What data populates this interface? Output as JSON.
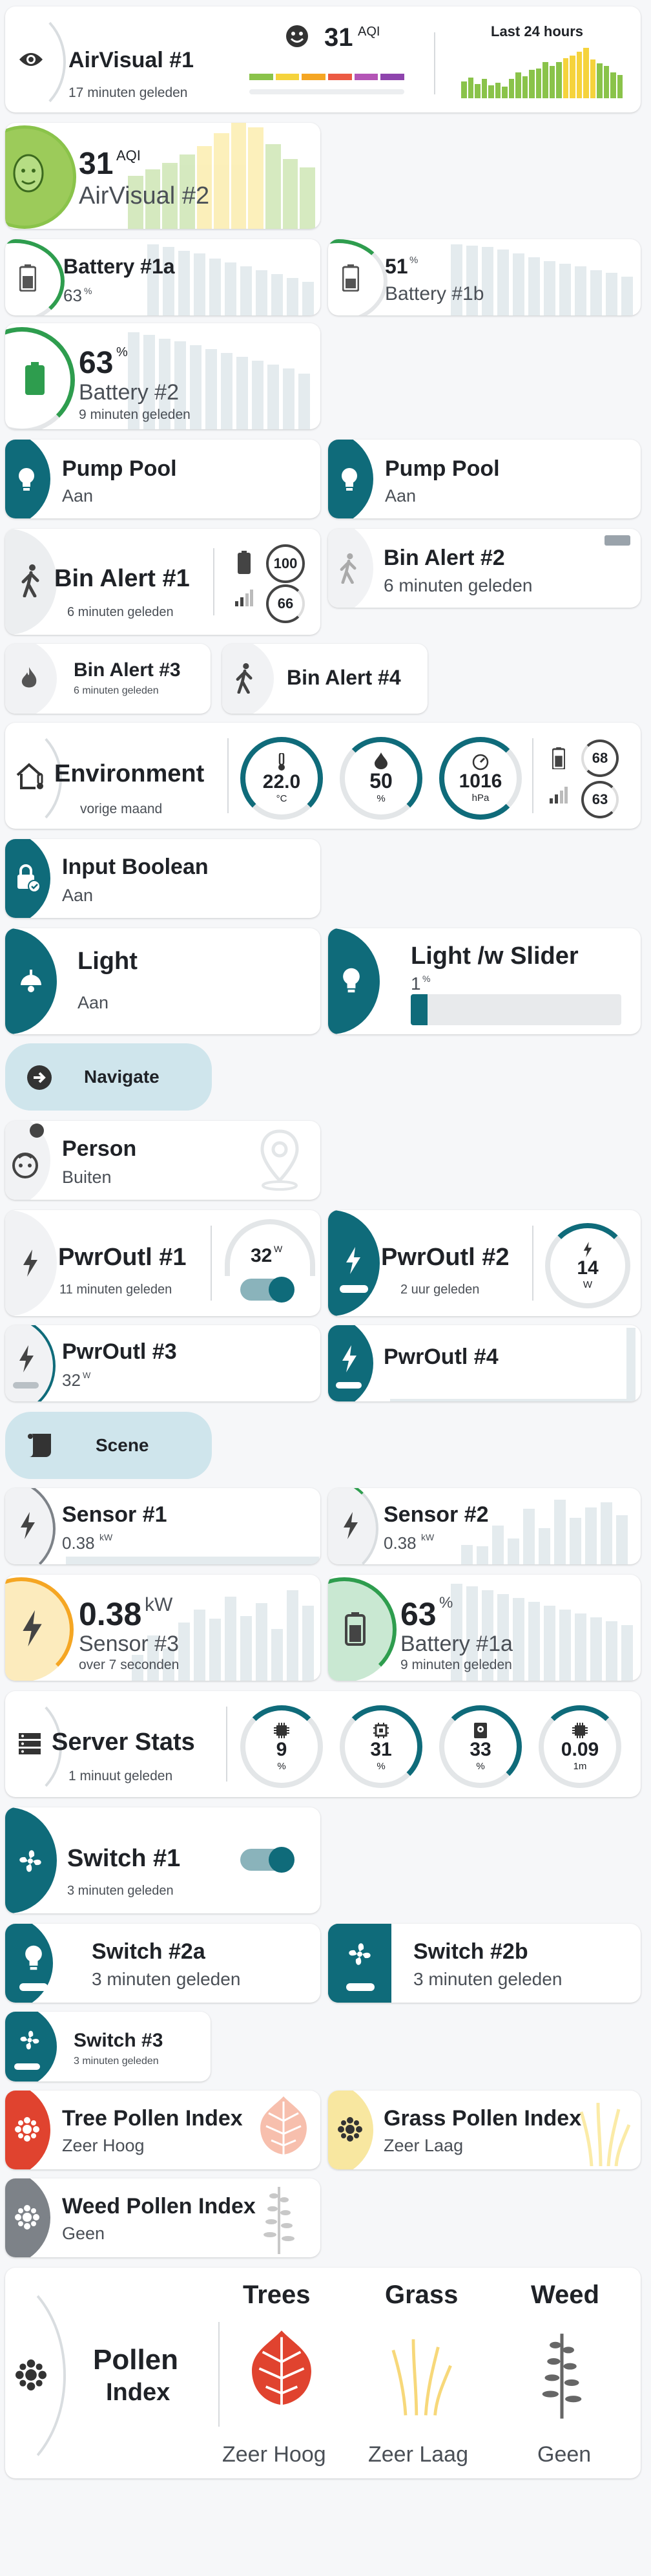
{
  "airvisual1": {
    "name": "AirVisual #1",
    "updated": "17 minuten geleden",
    "aqi": "31",
    "aqi_unit": "AQI",
    "history_label": "Last 24 hours"
  },
  "airvisual2": {
    "value": "31",
    "unit": "AQI",
    "name": "AirVisual #2"
  },
  "battery1a": {
    "name": "Battery #1a",
    "value": "63",
    "unit": "%"
  },
  "battery1b": {
    "name": "Battery #1b",
    "value": "51",
    "unit": "%"
  },
  "battery2": {
    "value": "63",
    "unit": "%",
    "name": "Battery #2",
    "updated": "9 minuten geleden"
  },
  "pump1": {
    "name": "Pump Pool",
    "state": "Aan"
  },
  "pump2": {
    "name": "Pump Pool",
    "state": "Aan"
  },
  "binalert1": {
    "name": "Bin Alert #1",
    "updated": "6 minuten geleden",
    "battery": "100",
    "signal": "66"
  },
  "binalert2": {
    "name": "Bin Alert #2",
    "updated": "6 minuten geleden"
  },
  "binalert3": {
    "name": "Bin Alert #3",
    "updated": "6 minuten geleden"
  },
  "binalert4": {
    "name": "Bin Alert #4"
  },
  "environment": {
    "name": "Environment",
    "updated": "vorige maand",
    "temp": "22.0",
    "temp_unit": "°C",
    "humidity": "50",
    "humidity_unit": "%",
    "pressure": "1016",
    "pressure_unit": "hPa",
    "battery": "68",
    "signal": "63"
  },
  "inputboolean": {
    "name": "Input Boolean",
    "state": "Aan"
  },
  "light": {
    "name": "Light",
    "state": "Aan"
  },
  "lightslider": {
    "name": "Light /w Slider",
    "value": "1",
    "unit": "%",
    "level": 0.08
  },
  "navigate": {
    "label": "Navigate"
  },
  "person": {
    "name": "Person",
    "state": "Buiten"
  },
  "pwroutl1": {
    "name": "PwrOutl #1",
    "updated": "11 minuten geleden",
    "value": "32",
    "unit": "W"
  },
  "pwroutl2": {
    "name": "PwrOutl #2",
    "updated": "2 uur geleden",
    "value": "14",
    "unit": "W"
  },
  "pwroutl3": {
    "name": "PwrOutl #3",
    "value": "32",
    "unit": "W"
  },
  "pwroutl4": {
    "name": "PwrOutl #4"
  },
  "scene": {
    "label": "Scene"
  },
  "sensor1": {
    "name": "Sensor #1",
    "value": "0.38",
    "unit": "kW"
  },
  "sensor2": {
    "name": "Sensor #2",
    "value": "0.38",
    "unit": "kW"
  },
  "sensor3": {
    "value": "0.38",
    "unit": "kW",
    "name": "Sensor #3",
    "updated": "over 7 seconden"
  },
  "battery1a_big": {
    "value": "63",
    "unit": "%",
    "name": "Battery #1a",
    "updated": "9 minuten geleden"
  },
  "serverstats": {
    "name": "Server Stats",
    "updated": "1 minuut geleden",
    "cpu": "9",
    "cpu_unit": "%",
    "mem": "31",
    "mem_unit": "%",
    "disk": "33",
    "disk_unit": "%",
    "load": "0.09",
    "load_unit": "1m"
  },
  "switch1": {
    "name": "Switch #1",
    "updated": "3 minuten geleden"
  },
  "switch2a": {
    "name": "Switch #2a",
    "updated": "3 minuten geleden"
  },
  "switch2b": {
    "name": "Switch #2b",
    "updated": "3 minuten geleden"
  },
  "switch3": {
    "name": "Switch #3",
    "updated": "3 minuten geleden"
  },
  "treepollen": {
    "name": "Tree Pollen Index",
    "state": "Zeer Hoog"
  },
  "grasspollen": {
    "name": "Grass Pollen Index",
    "state": "Zeer Laag"
  },
  "weedpollen": {
    "name": "Weed Pollen Index",
    "state": "Geen"
  },
  "pollen": {
    "title_line1": "Pollen",
    "title_line2": "Index",
    "trees_label": "Trees",
    "trees_state": "Zeer Hoog",
    "grass_label": "Grass",
    "grass_state": "Zeer Laag",
    "weed_label": "Weed",
    "weed_state": "Geen"
  },
  "colors": {
    "teal": "#0f6b7a",
    "green": "#2e9d4e",
    "yellow": "#f7c948",
    "red": "#e0432f",
    "gray": "#7d8288"
  }
}
